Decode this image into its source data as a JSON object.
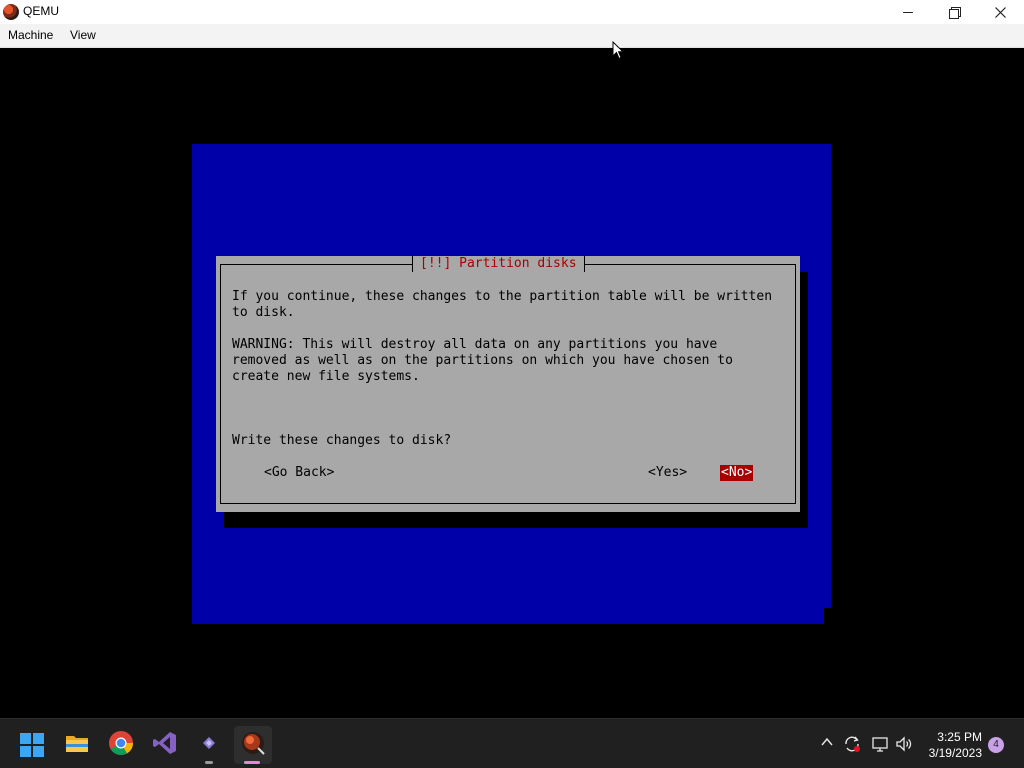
{
  "window": {
    "title": "QEMU",
    "icon": "qemu-icon",
    "controls": [
      "minimize-icon",
      "restore-icon",
      "close-icon"
    ]
  },
  "menu": {
    "machine": "Machine",
    "view": "View"
  },
  "dialog": {
    "title": "[!!] Partition disks",
    "body_line1": "If you continue, these changes to the partition table will be written\nto disk.",
    "body_line2": "WARNING: This will destroy all data on any partitions you have\nremoved as well as on the partitions on which you have chosen to\ncreate new file systems.",
    "question": "Write these changes to disk?",
    "buttons": {
      "go_back": "<Go Back>",
      "yes": "<Yes>",
      "no": "<No>"
    },
    "selected_button": "no",
    "colors": {
      "background": "#a8a8a8",
      "title": "#a80000",
      "selected_bg": "#a80000",
      "selected_fg": "#ffffff"
    }
  },
  "screen_colors": {
    "installer_bg": "#0000a8",
    "vm_bg": "#000000"
  },
  "taskbar": {
    "apps": [
      "windows-start-icon",
      "file-explorer-icon",
      "chrome-icon",
      "visual-studio-icon",
      "app-icon",
      "qemu-icon"
    ],
    "tray_icons": [
      "chevron-up-icon",
      "sync-icon",
      "network-icon",
      "volume-icon"
    ],
    "time": "3:25 PM",
    "date": "3/19/2023",
    "notification_count": "4"
  }
}
